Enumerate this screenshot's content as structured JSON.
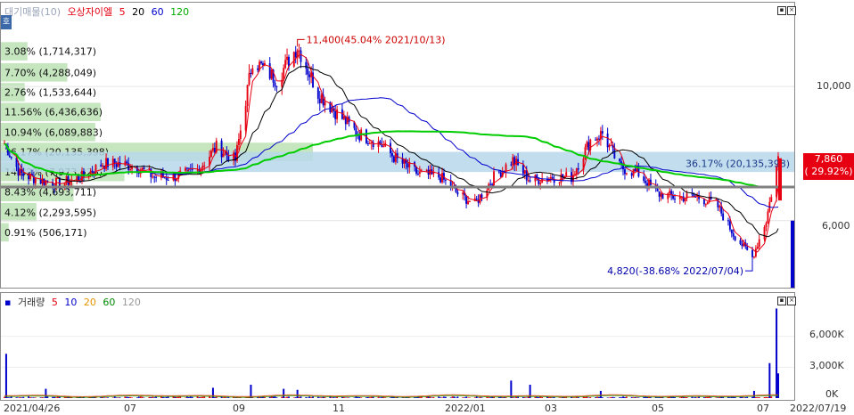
{
  "price_legend": {
    "dimmed_label": "대기매물(10)",
    "stock_name": "오상자이엘",
    "ma_labels": [
      "5",
      "20",
      "60",
      "120"
    ]
  },
  "volume_legend": {
    "title": "거래량",
    "ma_labels": [
      "5",
      "10",
      "20",
      "60",
      "120"
    ]
  },
  "colors": {
    "up": "#e60012",
    "down": "#0000cc",
    "ma5": "#e60012",
    "ma20": "#000000",
    "ma60": "#0000cc",
    "ma120": "#00cc00",
    "profile": "#c6e6c0",
    "highlight_band": "#b7d7ea",
    "current_line": "#808080"
  },
  "side_tab_label": "호",
  "current_price": {
    "value": "7,860",
    "change": "( 29.92%)"
  },
  "chart_data": [
    {
      "type": "candlestick",
      "title": "",
      "x_ticks": [
        "2021/04/26",
        "07",
        "09",
        "11",
        "2022/01",
        "03",
        "05",
        "07",
        "2022/07/19"
      ],
      "y_ticks": [
        "10,000",
        "6,000"
      ],
      "ylim": [
        4000,
        12500
      ],
      "series": [
        {
          "name": "5",
          "type": "moving-average"
        },
        {
          "name": "20",
          "type": "moving-average"
        },
        {
          "name": "60",
          "type": "moving-average"
        },
        {
          "name": "120",
          "type": "moving-average"
        }
      ],
      "close_path": [
        [
          "2021/04/26",
          8300
        ],
        [
          "2021/05/05",
          7400
        ],
        [
          "2021/05/17",
          7200
        ],
        [
          "2021/05/28",
          7100
        ],
        [
          "2021/06/10",
          7300
        ],
        [
          "2021/06/22",
          7700
        ],
        [
          "2021/07/01",
          7700
        ],
        [
          "2021/07/12",
          7600
        ],
        [
          "2021/07/22",
          7300
        ],
        [
          "2021/08/02",
          7300
        ],
        [
          "2021/08/16",
          7500
        ],
        [
          "2021/08/27",
          8200
        ],
        [
          "2021/09/07",
          7800
        ],
        [
          "2021/09/17",
          10800
        ],
        [
          "2021/10/01",
          10200
        ],
        [
          "2021/10/13",
          11200
        ],
        [
          "2021/10/25",
          9800
        ],
        [
          "2021/11/05",
          9200
        ],
        [
          "2021/11/17",
          8600
        ],
        [
          "2021/11/30",
          8300
        ],
        [
          "2021/12/10",
          7800
        ],
        [
          "2021/12/22",
          7400
        ],
        [
          "2022/01/04",
          7300
        ],
        [
          "2022/01/14",
          6800
        ],
        [
          "2022/01/24",
          6500
        ],
        [
          "2022/02/04",
          7300
        ],
        [
          "2022/02/15",
          7800
        ],
        [
          "2022/02/25",
          7200
        ],
        [
          "2022/03/10",
          7300
        ],
        [
          "2022/03/21",
          7300
        ],
        [
          "2022/04/01",
          8400
        ],
        [
          "2022/04/08",
          8600
        ],
        [
          "2022/04/18",
          7600
        ],
        [
          "2022/04/29",
          7400
        ],
        [
          "2022/05/10",
          6800
        ],
        [
          "2022/05/20",
          6700
        ],
        [
          "2022/06/02",
          6700
        ],
        [
          "2022/06/13",
          6500
        ],
        [
          "2022/06/23",
          5600
        ],
        [
          "2022/07/04",
          4900
        ],
        [
          "2022/07/12",
          6000
        ],
        [
          "2022/07/19",
          7860
        ]
      ],
      "support_level": 7000,
      "highlight_band": [
        7450,
        8050
      ],
      "annotations": [
        {
          "label": "11,400(45.04% 2021/10/13)",
          "date": "2021/10/13",
          "value": 11400
        },
        {
          "label": "4,820(-38.68% 2022/07/04)",
          "date": "2022/07/04",
          "value": 4820
        },
        {
          "label": "36.17% (20,135,398)",
          "value": 7700
        }
      ],
      "volume_profile": [
        {
          "label": "3.08% (1,714,317)",
          "pct": 3.08,
          "value": 11050
        },
        {
          "label": "7.70% (4,288,049)",
          "pct": 7.7,
          "value": 10420
        },
        {
          "label": "2.76% (1,533,644)",
          "pct": 2.76,
          "value": 9830
        },
        {
          "label": "11.56% (6,436,636)",
          "pct": 11.56,
          "value": 9240
        },
        {
          "label": "10.94% (6,089,883)",
          "pct": 10.94,
          "value": 8640
        },
        {
          "label": "36.17% (20,135,398)",
          "pct": 36.17,
          "value": 8050
        },
        {
          "label": "14.32% (7,973,026)",
          "pct": 14.32,
          "value": 7450
        },
        {
          "label": "8.43% (4,693,711)",
          "pct": 8.43,
          "value": 6850
        },
        {
          "label": "4.12% (2,293,595)",
          "pct": 4.12,
          "value": 6250
        },
        {
          "label": "0.91% (506,171)",
          "pct": 0.91,
          "value": 5650
        }
      ]
    },
    {
      "type": "bar",
      "title": "",
      "y_ticks": [
        "6,000K",
        "3,000K",
        "0K"
      ],
      "ylim": [
        0,
        9000
      ],
      "unit": "K",
      "values": [
        [
          "2021/04/27",
          4300
        ],
        [
          "2021/05/20",
          900
        ],
        [
          "2021/08/25",
          1000
        ],
        [
          "2021/09/16",
          1300
        ],
        [
          "2021/10/05",
          900
        ],
        [
          "2021/10/13",
          800
        ],
        [
          "2022/02/14",
          1700
        ],
        [
          "2022/02/25",
          1300
        ],
        [
          "2022/04/07",
          700
        ],
        [
          "2022/07/05",
          700
        ],
        [
          "2022/07/14",
          3400
        ],
        [
          "2022/07/18",
          8700
        ],
        [
          "2022/07/19",
          2400
        ]
      ]
    }
  ]
}
